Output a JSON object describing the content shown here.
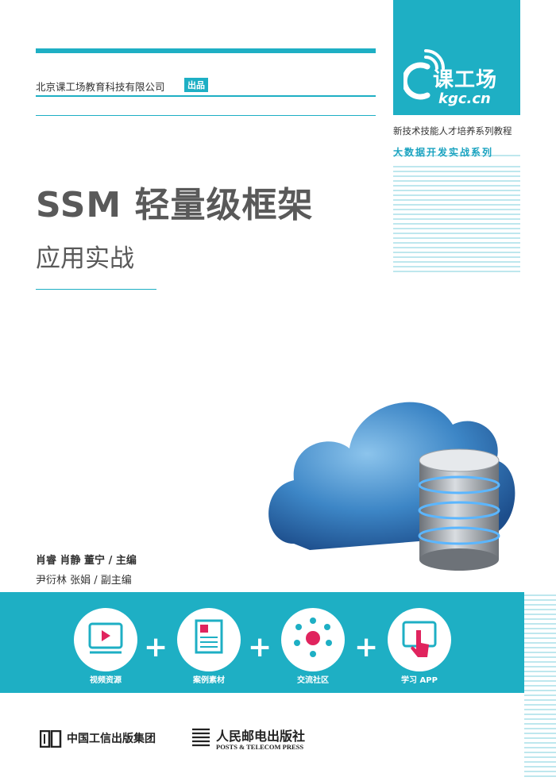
{
  "brand": {
    "logo_cn": "课工场",
    "logo_en": "kgc.cn",
    "series_line1": "新技术技能人才培养系列教程",
    "series_line2": "大数据开发实战系列"
  },
  "publisher": {
    "name": "北京课工场教育科技有限公司",
    "badge": "出品"
  },
  "book": {
    "title": "SSM 轻量级框架",
    "subtitle": "应用实战"
  },
  "authors": {
    "editors": "肖睿  肖静  董宁 / 主编",
    "deputy": "尹衍林  张娟 / 副主编"
  },
  "features": [
    {
      "label": "视频资源",
      "icon": "video-icon"
    },
    {
      "label": "案例素材",
      "icon": "document-icon"
    },
    {
      "label": "交流社区",
      "icon": "community-icon"
    },
    {
      "label": "学习 APP",
      "icon": "touch-app-icon"
    }
  ],
  "plus_sign": "+",
  "footer": {
    "group": "中国工信出版集团",
    "press_cn": "人民邮电出版社",
    "press_en": "POSTS & TELECOM PRESS"
  },
  "colors": {
    "accent": "#1eafc4",
    "title_gray": "#595959"
  }
}
